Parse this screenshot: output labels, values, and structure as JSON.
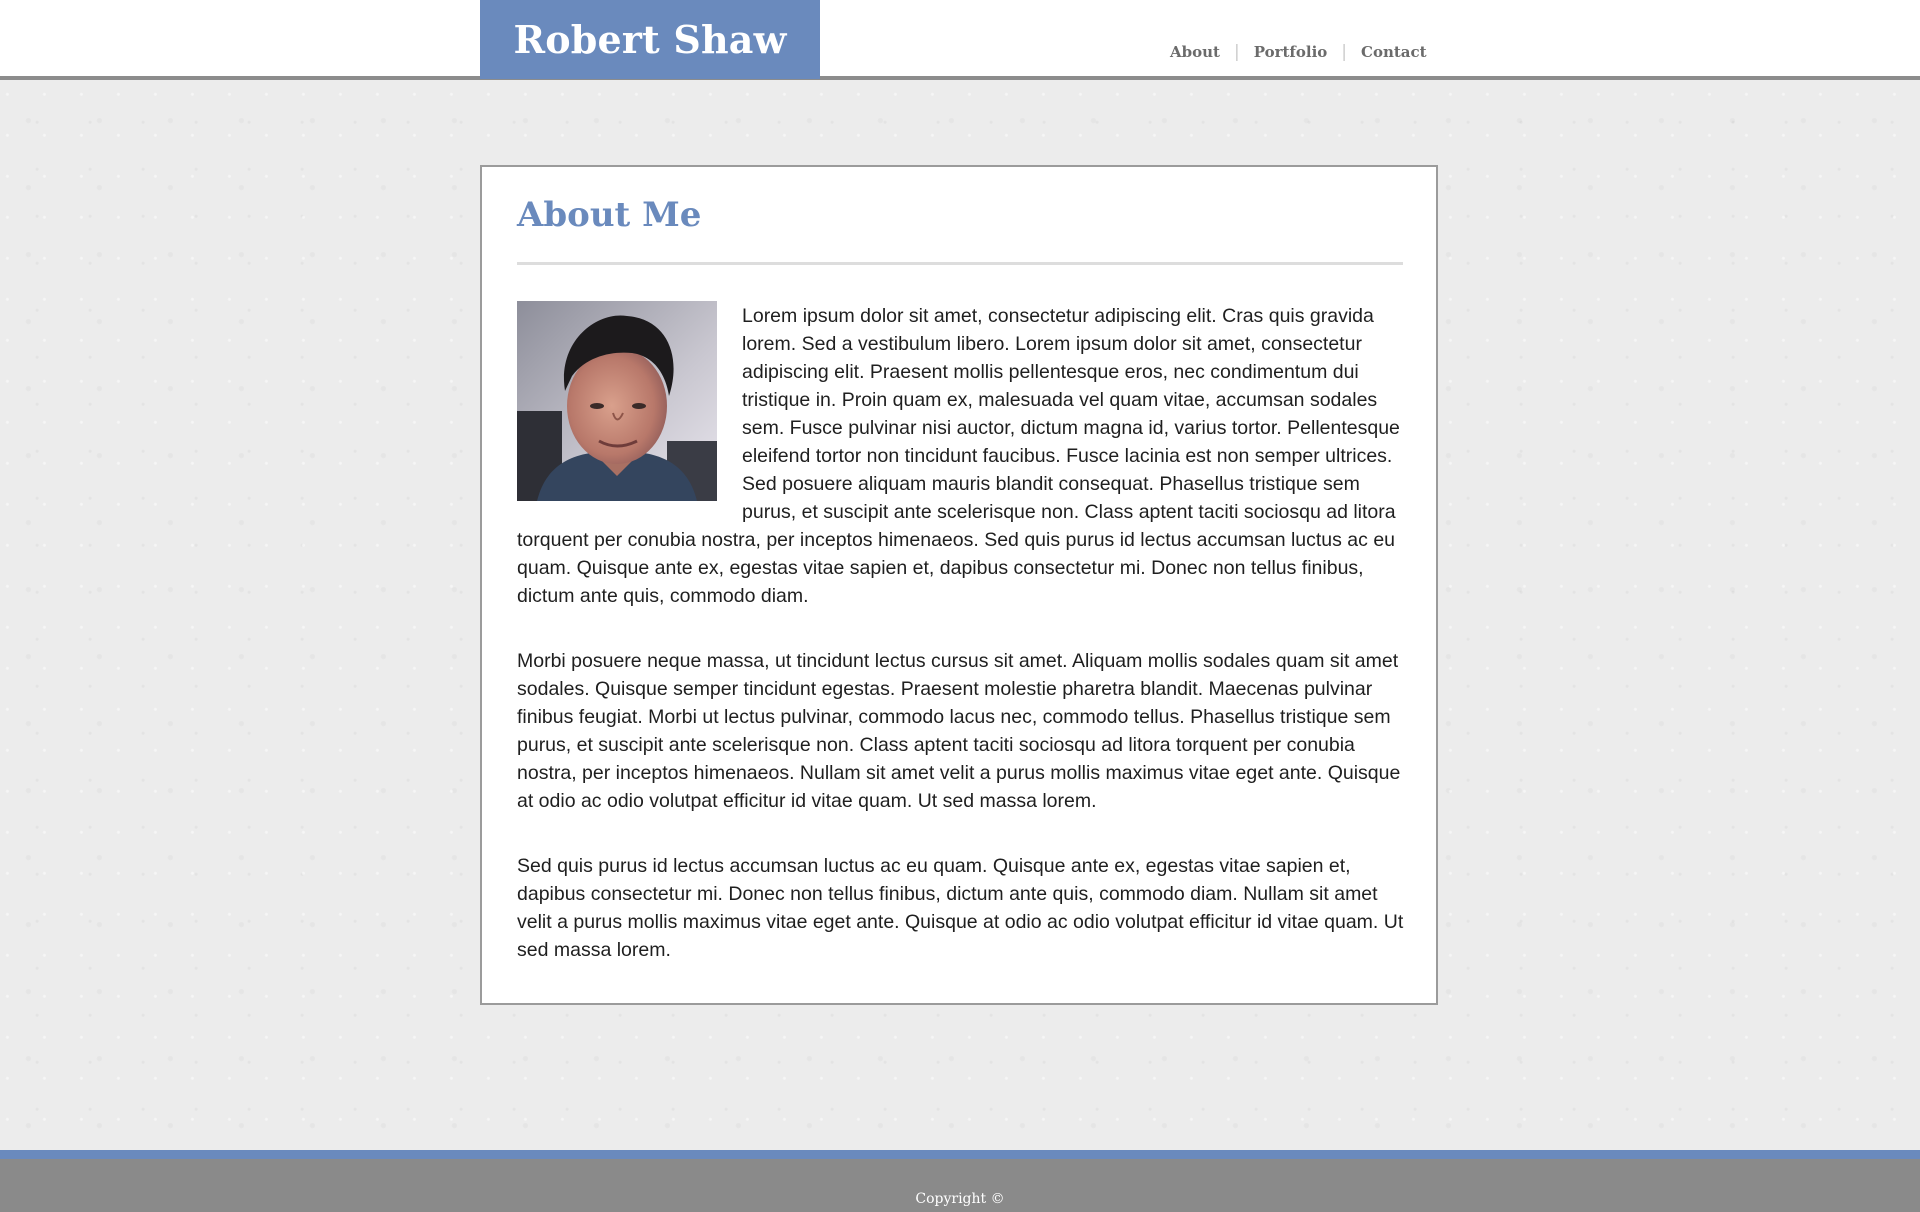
{
  "header": {
    "brand": "Robert Shaw",
    "nav": {
      "about": "About",
      "portfolio": "Portfolio",
      "contact": "Contact",
      "separator": "|"
    }
  },
  "colors": {
    "accent": "#6a8abd",
    "header_border": "#8c8c8c",
    "footer_bg": "#8a8a8a",
    "body_bg": "#ececec"
  },
  "main": {
    "title": "About Me",
    "avatar_icon": "profile-photo",
    "paragraphs": [
      "Lorem ipsum dolor sit amet, consectetur adipiscing elit. Cras quis gravida lorem. Sed a vestibulum libero. Lorem ipsum dolor sit amet, consectetur adipiscing elit. Praesent mollis pellentesque eros, nec condimentum dui tristique in. Proin quam ex, malesuada vel quam vitae, accumsan sodales sem. Fusce pulvinar nisi auctor, dictum magna id, varius tortor. Pellentesque eleifend tortor non tincidunt faucibus. Fusce lacinia est non semper ultrices. Sed posuere aliquam mauris blandit consequat. Phasellus tristique sem purus, et suscipit ante scelerisque non. Class aptent taciti sociosqu ad litora torquent per conubia nostra, per inceptos himenaeos. Sed quis purus id lectus accumsan luctus ac eu quam. Quisque ante ex, egestas vitae sapien et, dapibus consectetur mi. Donec non tellus finibus, dictum ante quis, commodo diam.",
      "Morbi posuere neque massa, ut tincidunt lectus cursus sit amet. Aliquam mollis sodales quam sit amet sodales. Quisque semper tincidunt egestas. Praesent molestie pharetra blandit. Maecenas pulvinar finibus feugiat. Morbi ut lectus pulvinar, commodo lacus nec, commodo tellus. Phasellus tristique sem purus, et suscipit ante scelerisque non. Class aptent taciti sociosqu ad litora torquent per conubia nostra, per inceptos himenaeos. Nullam sit amet velit a purus mollis maximus vitae eget ante. Quisque at odio ac odio volutpat efficitur id vitae quam. Ut sed massa lorem.",
      "Sed quis purus id lectus accumsan luctus ac eu quam. Quisque ante ex, egestas vitae sapien et, dapibus consectetur mi. Donec non tellus finibus, dictum ante quis, commodo diam. Nullam sit amet velit a purus mollis maximus vitae eget ante. Quisque at odio ac odio volutpat efficitur id vitae quam. Ut sed massa lorem."
    ]
  },
  "footer": {
    "copyright": "Copyright ©"
  }
}
